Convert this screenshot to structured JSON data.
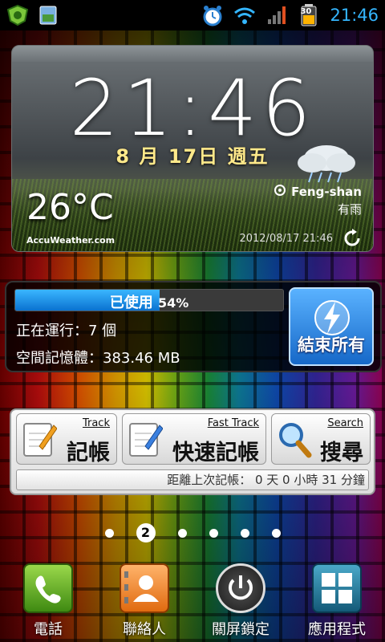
{
  "status_bar": {
    "time": "21:46",
    "battery_level": "30",
    "icons": [
      "shield-app-icon",
      "photo-app-icon",
      "alarm-icon",
      "wifi-icon",
      "signal-icon",
      "battery-icon"
    ]
  },
  "clock_widget": {
    "time": "21:46",
    "date": "8 月 17日 週五",
    "temperature": "26°C",
    "provider": "AccuWeather.com",
    "location": "Feng-shan",
    "condition": "有雨",
    "updated": "2012/08/17  21:46"
  },
  "task_widget": {
    "used_label": "已使用",
    "used_percent": "54%",
    "used_fraction": 0.54,
    "running": "正在運行：7 個",
    "free_memory": "空間記憶體：383.46  MB",
    "end_all_label": "結束所有"
  },
  "track_widget": {
    "buttons": [
      {
        "en": "Track",
        "zh": "記帳"
      },
      {
        "en": "Fast Track",
        "zh": "快速記帳"
      },
      {
        "en": "Search",
        "zh": "搜尋"
      }
    ],
    "since_last": "距離上次記帳：  0 天  0 小時  31 分鐘"
  },
  "pager": {
    "current": "2"
  },
  "dock": [
    {
      "label": "電話"
    },
    {
      "label": "聯絡人"
    },
    {
      "label": "關屏鎖定"
    },
    {
      "label": "應用程式"
    }
  ],
  "colors": {
    "status_time": "#34b6ff",
    "date_color": "#ffe98a",
    "accent_blue": "#1668c8"
  }
}
